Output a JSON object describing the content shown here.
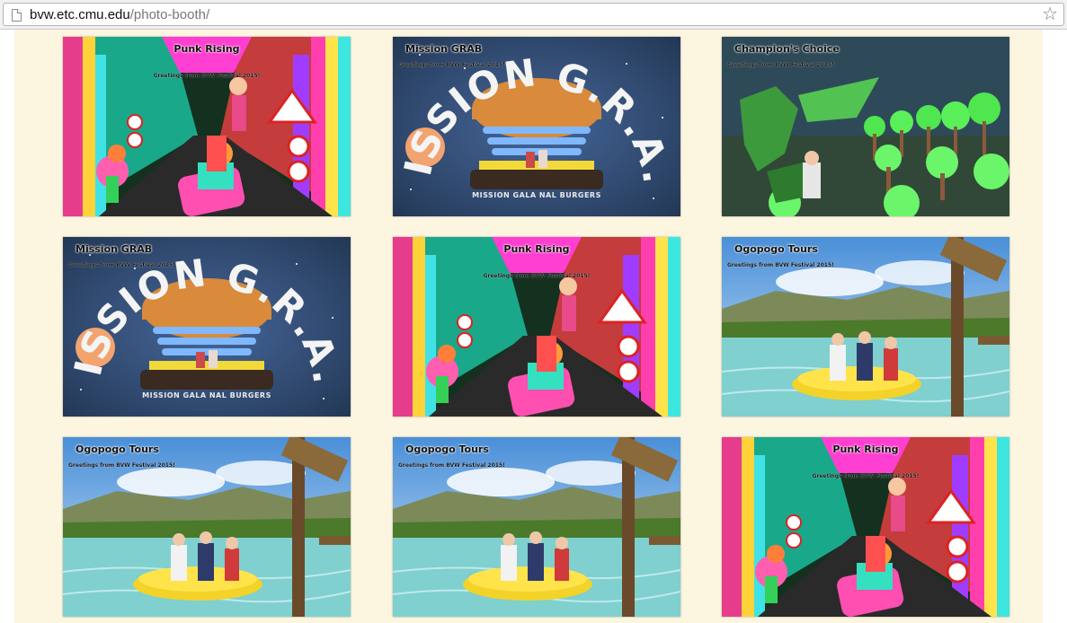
{
  "browser": {
    "url_host": "bvw.etc.cmu.edu",
    "url_path": "/photo-booth/",
    "page_icon": "page-icon",
    "bookmark_icon": "star-icon"
  },
  "gallery": {
    "photos": [
      {
        "scene": "punk",
        "title": "Punk Rising",
        "greeting": "Greetings from BVW Festival 2015!"
      },
      {
        "scene": "grab",
        "title": "Mission GRAB",
        "greeting": "Greetings from BVW Festival 2015!",
        "arc": "MISSION G.R.A.B",
        "subtitle": "MISSION GALA          NAL BURGERS"
      },
      {
        "scene": "champion",
        "title": "Champion's Choice",
        "greeting": "Greetings from BVW Festival 2015!"
      },
      {
        "scene": "grab",
        "title": "Mission GRAB",
        "greeting": "Greetings from BVW Festival 2015!",
        "arc": "MISSION G.R.A.B",
        "subtitle": "MISSION GALA          NAL BURGERS"
      },
      {
        "scene": "punk",
        "title": "Punk Rising",
        "greeting": "Greetings from BVW Festival 2015!"
      },
      {
        "scene": "ogopogo",
        "title": "Ogopogo Tours",
        "greeting": "Greetings from BVW Festival 2015!"
      },
      {
        "scene": "ogopogo",
        "title": "Ogopogo Tours",
        "greeting": "Greetings from BVW Festival 2015!"
      },
      {
        "scene": "ogopogo",
        "title": "Ogopogo Tours",
        "greeting": "Greetings from BVW Festival 2015!"
      },
      {
        "scene": "punk",
        "title": "Punk Rising",
        "greeting": "Greetings from BVW Festival 2015!"
      }
    ]
  },
  "colors": {
    "page_background": "#fcf6e0",
    "punk_magenta": "#ff2fbf",
    "grab_space": "#2f4a6e",
    "forest_green": "#4fe64f",
    "lake_teal": "#7fd0cf"
  }
}
